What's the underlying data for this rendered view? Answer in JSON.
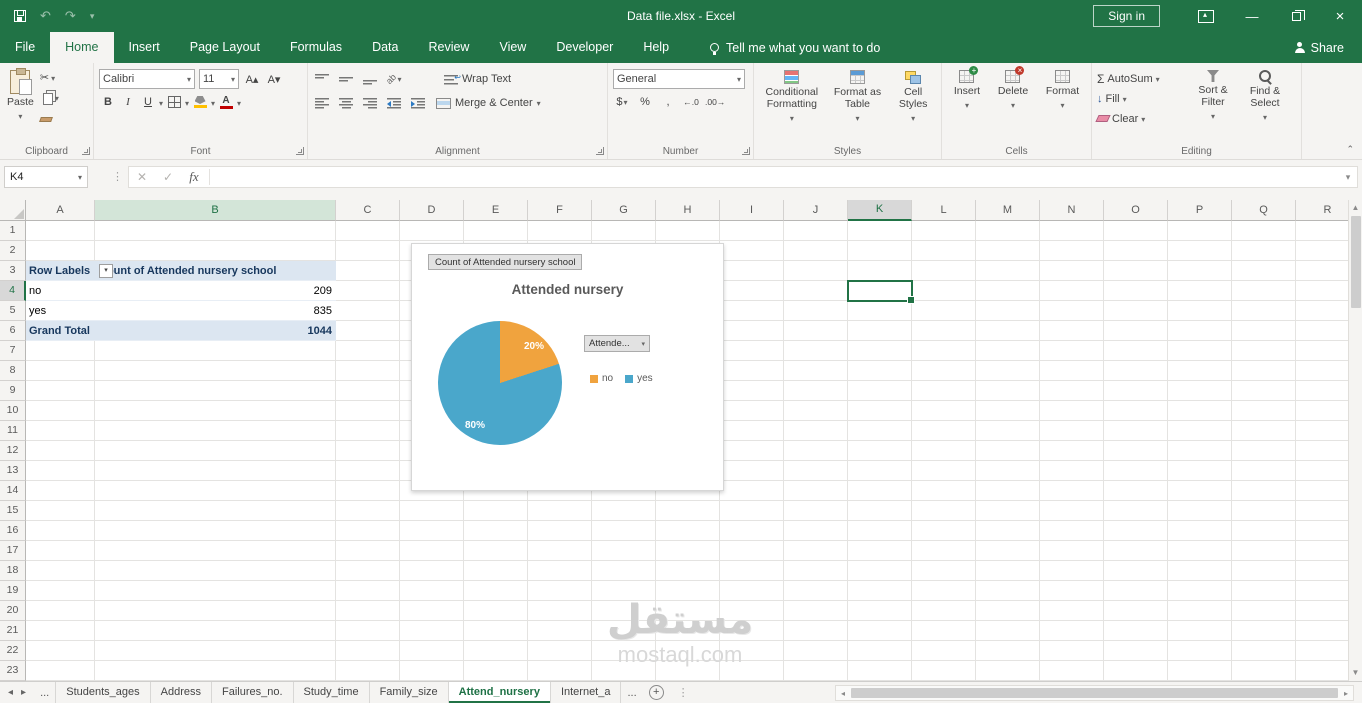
{
  "titlebar": {
    "title": "Data file.xlsx  -  Excel",
    "sign_in": "Sign in"
  },
  "ribbon_tabs": [
    "File",
    "Home",
    "Insert",
    "Page Layout",
    "Formulas",
    "Data",
    "Review",
    "View",
    "Developer",
    "Help"
  ],
  "active_ribbon_tab": "Home",
  "tell_me": "Tell me what you want to do",
  "share_label": "Share",
  "glyphs": {
    "undo": "↶",
    "redo": "↷",
    "cut": "✂",
    "bold": "B",
    "italic": "I",
    "underline": "U",
    "sigma": "Σ",
    "fill_arrow": "↓",
    "dollar": "$",
    "percent": "%",
    "comma": ",",
    "inc_decimal": "←.0",
    "dec_decimal": ".00→",
    "cancel": "✕",
    "check": "✓",
    "font_grow": "A▴",
    "font_shrink": "A▾"
  },
  "ribbon": {
    "clipboard": {
      "label": "Clipboard",
      "paste": "Paste"
    },
    "font": {
      "label": "Font",
      "font_name": "Calibri",
      "font_size": "11"
    },
    "alignment": {
      "label": "Alignment",
      "wrap_text": "Wrap Text",
      "merge_center": "Merge & Center"
    },
    "number": {
      "label": "Number",
      "format": "General"
    },
    "styles": {
      "label": "Styles",
      "conditional": "Conditional Formatting",
      "format_table": "Format as Table",
      "cell_styles": "Cell Styles"
    },
    "cells": {
      "label": "Cells",
      "insert": "Insert",
      "delete": "Delete",
      "format": "Format"
    },
    "editing": {
      "label": "Editing",
      "autosum": "AutoSum",
      "fill": "Fill",
      "clear": "Clear",
      "sort_filter": "Sort & Filter",
      "find_select": "Find & Select"
    }
  },
  "formula_bar": {
    "name_box": "K4",
    "fx": "fx",
    "formula": ""
  },
  "grid": {
    "columns": [
      "A",
      "B",
      "C",
      "D",
      "E",
      "F",
      "G",
      "H",
      "I",
      "J",
      "K",
      "L",
      "M",
      "N",
      "O",
      "P",
      "Q",
      "R"
    ],
    "rows": [
      1,
      2,
      3,
      4,
      5,
      6,
      7,
      8,
      9,
      10,
      11,
      12,
      13,
      14,
      15,
      16,
      17,
      18,
      19,
      20,
      21,
      22,
      23
    ],
    "selected_cell": "K4",
    "selected_column": "K",
    "selected_row": 4,
    "highlighted_column": "B"
  },
  "pivot": {
    "header": [
      "Row Labels",
      "Count of Attended nursery school"
    ],
    "rows": [
      [
        "no",
        "209"
      ],
      [
        "yes",
        "835"
      ]
    ],
    "total": [
      "Grand Total",
      "1044"
    ]
  },
  "chart_data": {
    "type": "pie",
    "title": "Attended nursery",
    "field_button": "Count of Attended nursery school",
    "axis_filter_button": "Attende...",
    "categories": [
      "no",
      "yes"
    ],
    "values": [
      209,
      835
    ],
    "percent_labels": [
      "20%",
      "80%"
    ],
    "colors": [
      "#f0a33e",
      "#4aa7cb"
    ],
    "legend_position": "right"
  },
  "sheet_bar": {
    "tabs": [
      "Students_ages",
      "Address",
      "Failures_no.",
      "Study_time",
      "Family_size",
      "Attend_nursery",
      "Internet_a"
    ],
    "active_tab": "Attend_nursery",
    "more_left": "...",
    "more_right": "...",
    "add_sheet": "+"
  },
  "watermark": {
    "line1": "مستقل",
    "line2": "mostaql.com"
  },
  "colors": {
    "accent_green": "#217346",
    "pivot_fill": "#dce6f1",
    "selection": "#217346"
  }
}
